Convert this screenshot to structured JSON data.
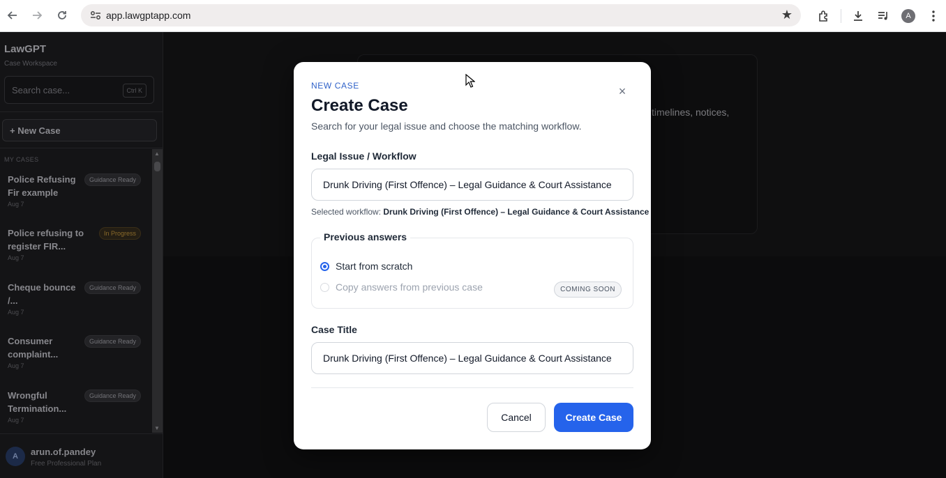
{
  "browser": {
    "url": "app.lawgptapp.com",
    "profile_initial": "A"
  },
  "sidebar": {
    "brand": "LawGPT",
    "brand_sub": "Case Workspace",
    "search_placeholder": "Search case...",
    "search_shortcut": "Ctrl K",
    "new_case_label": "+ New Case",
    "section_label": "MY CASES",
    "cases": [
      {
        "title": "Police Refusing Fir example",
        "date": "Aug 7",
        "badge": "Guidance Ready"
      },
      {
        "title": "Police refusing to register FIR...",
        "date": "Aug 7",
        "badge": "In Progress"
      },
      {
        "title": "Cheque bounce /...",
        "date": "Aug 7",
        "badge": "Guidance Ready"
      },
      {
        "title": "Consumer complaint...",
        "date": "Aug 7",
        "badge": "Guidance Ready"
      },
      {
        "title": "Wrongful Termination...",
        "date": "Aug 7",
        "badge": "Guidance Ready"
      }
    ],
    "user": {
      "initial": "A",
      "name": "arun.of.pandey",
      "plan": "Free Professional Plan"
    }
  },
  "main": {
    "background_text": "timelines, notices,"
  },
  "modal": {
    "eyebrow": "NEW CASE",
    "title": "Create Case",
    "close_glyph": "×",
    "subtitle": "Search for your legal issue and choose the matching workflow.",
    "workflow_label": "Legal Issue / Workflow",
    "workflow_value": "Drunk Driving (First Offence) – Legal Guidance & Court Assistance",
    "selected_prefix": "Selected workflow:",
    "selected_value": "Drunk Driving (First Offence) – Legal Guidance & Court Assistance",
    "previous_answers_label": "Previous answers",
    "option_scratch": "Start from scratch",
    "option_copy": "Copy answers from previous case",
    "coming_soon": "COMING SOON",
    "case_title_label": "Case Title",
    "case_title_value": "Drunk Driving (First Offence) – Legal Guidance & Court Assistance",
    "cancel_label": "Cancel",
    "create_label": "Create Case"
  },
  "colors": {
    "primary": "#2563eb",
    "eyebrow": "#2f62c9",
    "in_progress": "#8a6a2a"
  }
}
